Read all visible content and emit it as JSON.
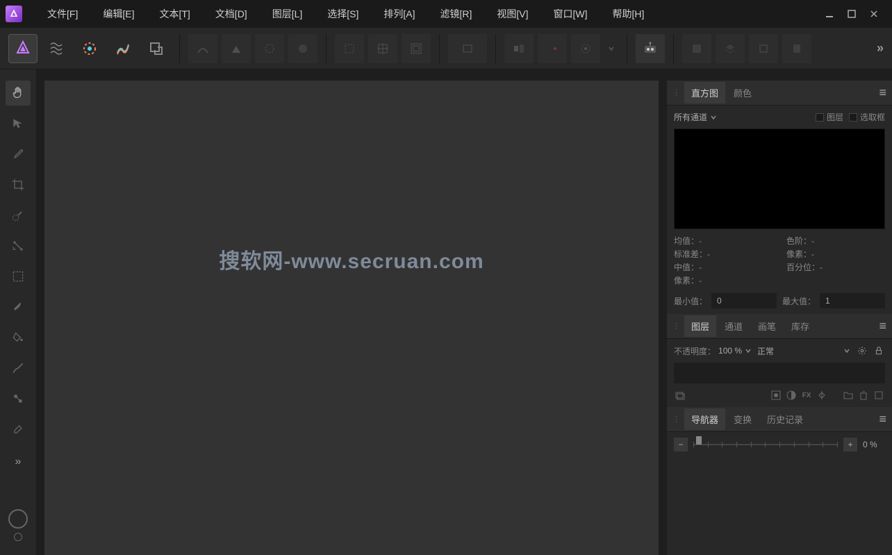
{
  "menu": {
    "items": [
      "文件[F]",
      "编辑[E]",
      "文本[T]",
      "文档[D]",
      "图层[L]",
      "选择[S]",
      "排列[A]",
      "滤镜[R]",
      "视图[V]",
      "窗口[W]",
      "帮助[H]"
    ]
  },
  "watermark": "搜软网-www.secruan.com",
  "panels": {
    "histogram": {
      "tabs": [
        "直方图",
        "颜色"
      ],
      "active": 0,
      "channel": "所有通道",
      "check_layer": "图层",
      "check_selection": "选取框",
      "stats": {
        "mean": "均值：-",
        "stddev": "标准差：-",
        "median": "中值：-",
        "pixels": "像素：-",
        "levels": "色阶：-",
        "px2": "像素：-",
        "percentile": "百分位：-"
      },
      "min_label": "最小值：",
      "min_val": "0",
      "max_label": "最大值：",
      "max_val": "1"
    },
    "layers": {
      "tabs": [
        "图层",
        "通道",
        "画笔",
        "库存"
      ],
      "active": 0,
      "opacity_label": "不透明度：",
      "opacity_val": "100 %",
      "blend": "正常"
    },
    "navigator": {
      "tabs": [
        "导航器",
        "变换",
        "历史记录"
      ],
      "active": 0,
      "zoom": "0 %"
    }
  }
}
